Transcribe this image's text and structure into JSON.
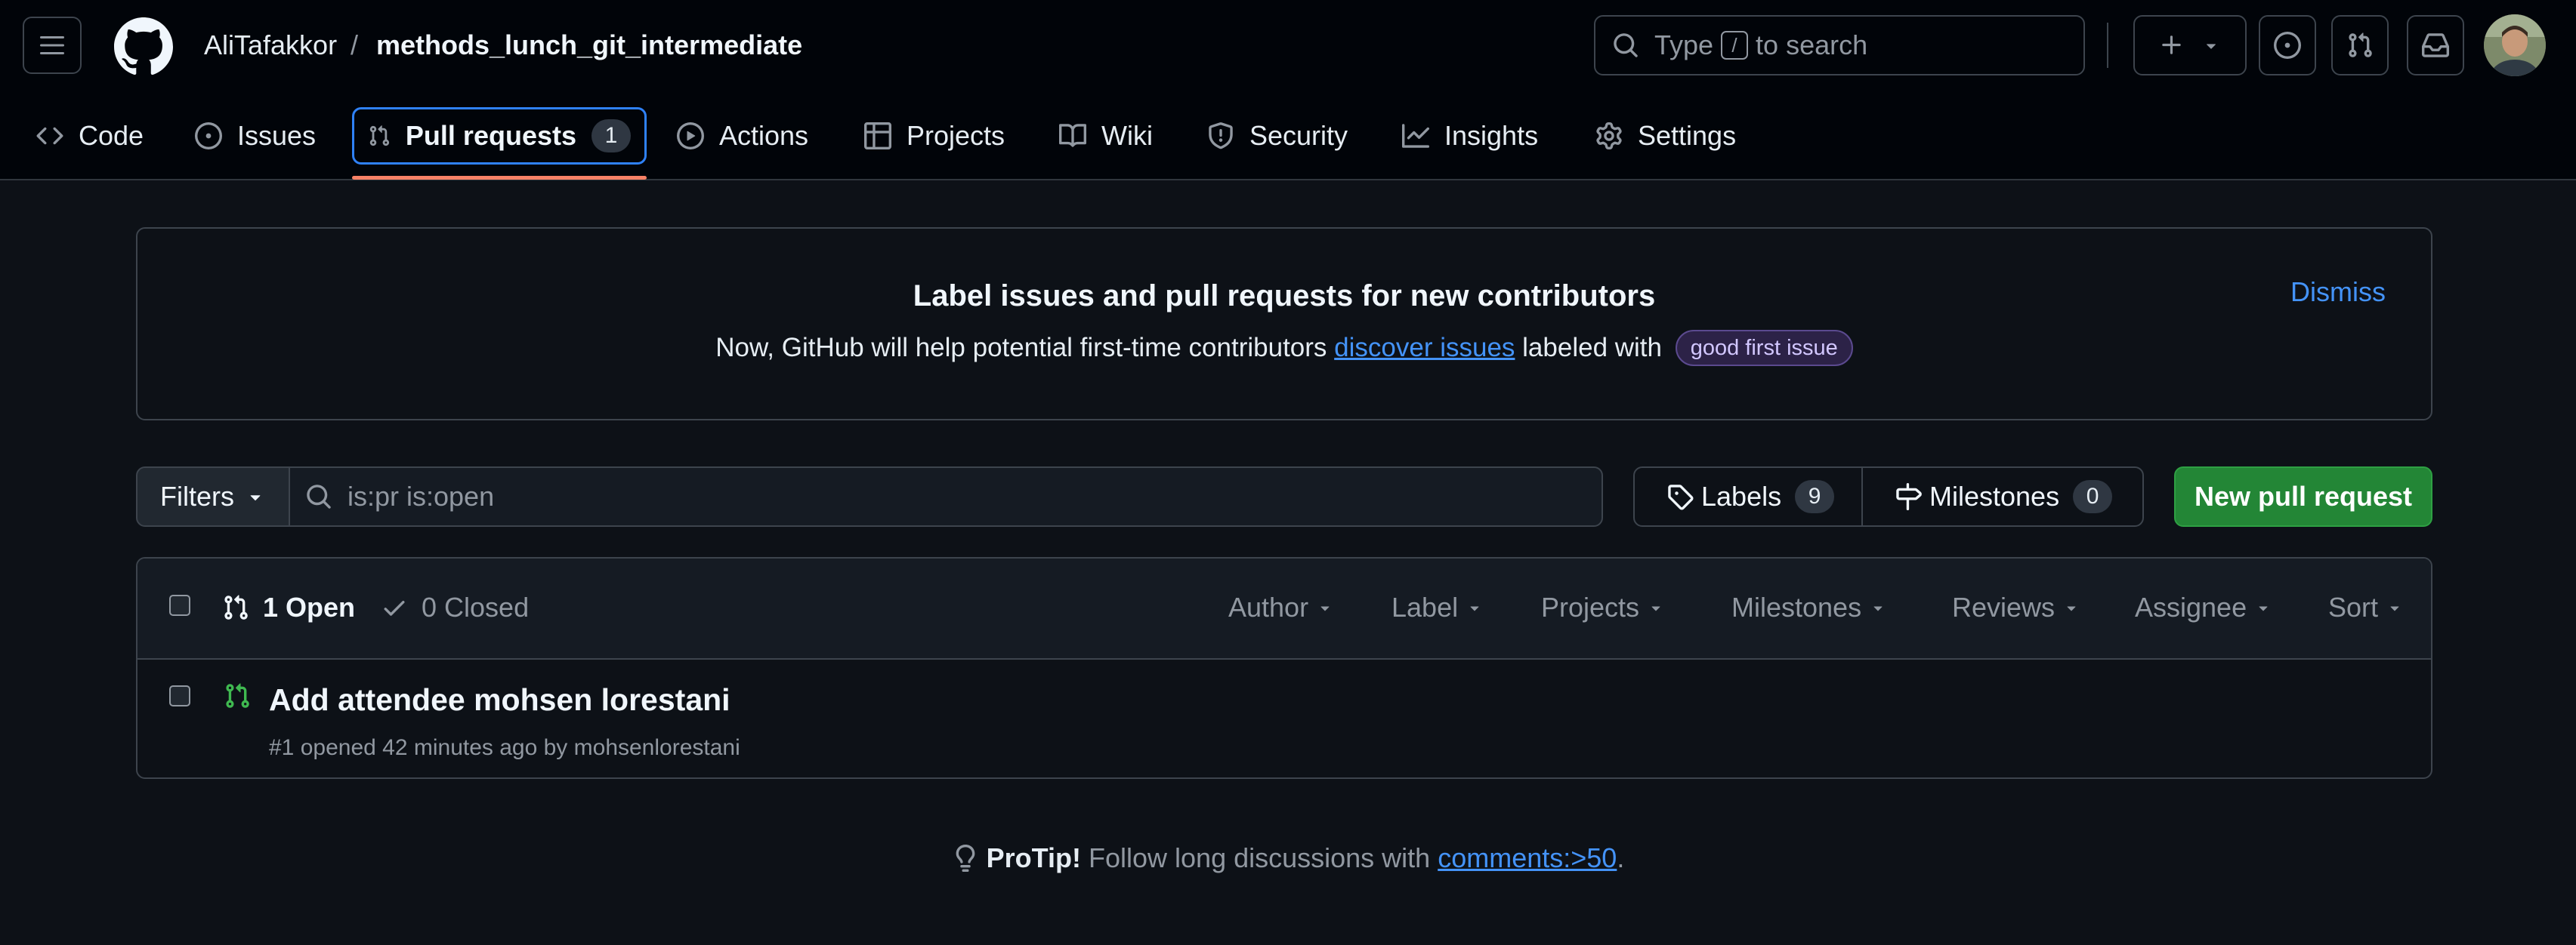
{
  "header": {
    "owner": "AliTafakkor",
    "separator": "/",
    "repo": "methods_lunch_git_intermediate",
    "search_prefix": "Type",
    "search_key": "/",
    "search_suffix": "to search"
  },
  "nav": {
    "tabs": [
      {
        "label": "Code",
        "icon": "code-icon"
      },
      {
        "label": "Issues",
        "icon": "issue-opened-icon"
      },
      {
        "label": "Pull requests",
        "icon": "git-pull-request-icon",
        "count": "1",
        "active": true
      },
      {
        "label": "Actions",
        "icon": "play-icon"
      },
      {
        "label": "Projects",
        "icon": "table-icon"
      },
      {
        "label": "Wiki",
        "icon": "book-icon"
      },
      {
        "label": "Security",
        "icon": "shield-icon"
      },
      {
        "label": "Insights",
        "icon": "graph-icon"
      },
      {
        "label": "Settings",
        "icon": "gear-icon"
      }
    ]
  },
  "banner": {
    "title": "Label issues and pull requests for new contributors",
    "desc_before": "Now, GitHub will help potential first-time contributors",
    "desc_link": "discover issues",
    "desc_after": "labeled with",
    "label": "good first issue",
    "dismiss": "Dismiss"
  },
  "filterbar": {
    "filters_label": "Filters",
    "query": "is:pr is:open",
    "labels_label": "Labels",
    "labels_count": "9",
    "milestones_label": "Milestones",
    "milestones_count": "0",
    "new_pr_label": "New pull request"
  },
  "list": {
    "open_label": "1 Open",
    "closed_label": "0 Closed",
    "sort_options": [
      "Author",
      "Label",
      "Projects",
      "Milestones",
      "Reviews",
      "Assignee",
      "Sort"
    ],
    "rows": [
      {
        "title": "Add attendee mohsen lorestani",
        "meta": "#1 opened 42 minutes ago by mohsenlorestani"
      }
    ]
  },
  "protip": {
    "bold": "ProTip!",
    "text": "Follow long discussions with",
    "link": "comments:>50",
    "end": "."
  },
  "colors": {
    "background": "#0d1117",
    "header": "#010409",
    "accent_blue": "#4493f8",
    "open_green": "#3fb950",
    "primary_button": "#238636",
    "tab_underline": "#f78166"
  }
}
